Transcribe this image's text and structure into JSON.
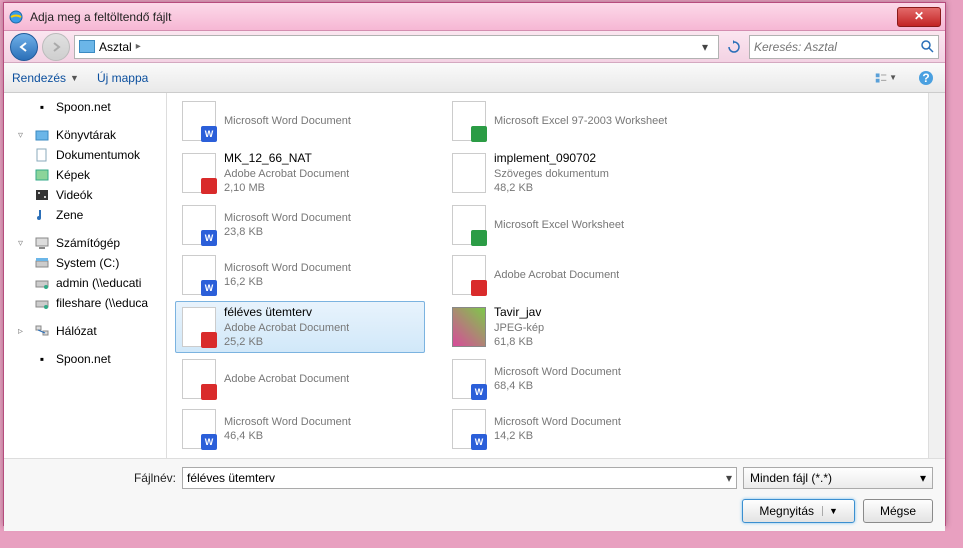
{
  "window": {
    "title": "Adja meg a feltöltendő fájlt"
  },
  "nav": {
    "path_location": "Asztal",
    "search_placeholder": "Keresés: Asztal"
  },
  "toolbar": {
    "organize": "Rendezés",
    "newfolder": "Új mappa"
  },
  "sidebar": {
    "spoon1": "Spoon.net",
    "libraries": "Könyvtárak",
    "documents": "Dokumentumok",
    "pictures": "Képek",
    "videos": "Videók",
    "music": "Zene",
    "computer": "Számítógép",
    "drive_c": "System (C:)",
    "drive_admin": "admin (\\\\educati",
    "drive_fileshare": "fileshare (\\\\educa",
    "network": "Hálózat",
    "spoon2": "Spoon.net"
  },
  "files": {
    "left": [
      {
        "name": "",
        "type": "Microsoft Word Document",
        "size": "",
        "kind": "doc"
      },
      {
        "name": "MK_12_66_NAT",
        "type": "Adobe Acrobat Document",
        "size": "2,10 MB",
        "kind": "pdf"
      },
      {
        "name": "",
        "type": "Microsoft Word Document",
        "size": "23,8 KB",
        "kind": "doc"
      },
      {
        "name": "",
        "type": "Microsoft Word Document",
        "size": "16,2 KB",
        "kind": "doc"
      },
      {
        "name": "féléves ütemterv",
        "type": "Adobe Acrobat Document",
        "size": "25,2 KB",
        "kind": "pdf",
        "selected": true
      },
      {
        "name": "",
        "type": "Adobe Acrobat Document",
        "size": "",
        "kind": "pdf"
      },
      {
        "name": "",
        "type": "Microsoft Word Document",
        "size": "46,4 KB",
        "kind": "doc"
      }
    ],
    "right": [
      {
        "name": "",
        "type": "Microsoft Excel 97-2003 Worksheet",
        "size": "",
        "kind": "xls"
      },
      {
        "name": "implement_090702",
        "type": "Szöveges dokumentum",
        "size": "48,2 KB",
        "kind": "txt"
      },
      {
        "name": "",
        "type": "Microsoft Excel Worksheet",
        "size": "",
        "kind": "xls"
      },
      {
        "name": "",
        "type": "Adobe Acrobat Document",
        "size": "",
        "kind": "pdf"
      },
      {
        "name": "Tavir_jav",
        "type": "JPEG-kép",
        "size": "61,8 KB",
        "kind": "jpg"
      },
      {
        "name": "",
        "type": "Microsoft Word Document",
        "size": "68,4 KB",
        "kind": "doc"
      },
      {
        "name": "",
        "type": "Microsoft Word Document",
        "size": "14,2 KB",
        "kind": "doc"
      }
    ]
  },
  "bottom": {
    "filename_label": "Fájlnév:",
    "filename_value": "féléves ütemterv",
    "filter": "Minden fájl (*.*)",
    "open": "Megnyitás",
    "cancel": "Mégse"
  }
}
